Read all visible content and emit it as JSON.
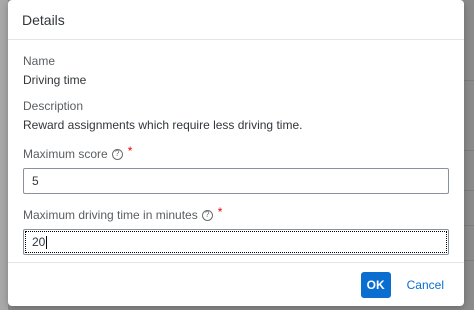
{
  "dialog": {
    "title": "Details",
    "name_label": "Name",
    "name_value": "Driving time",
    "description_label": "Description",
    "description_value": "Reward assignments which require less driving time.",
    "max_score_label": "Maximum score",
    "max_score_value": "5",
    "max_drive_label": "Maximum driving time in minutes",
    "max_drive_value": "20",
    "required_mark": "*",
    "help_glyph": "?",
    "ok_label": "OK",
    "cancel_label": "Cancel"
  },
  "colors": {
    "accent": "#0a6ed1",
    "required": "#ee0000",
    "overlay": "#8b8b8b"
  },
  "icons": {
    "help": "question-circle-icon"
  }
}
